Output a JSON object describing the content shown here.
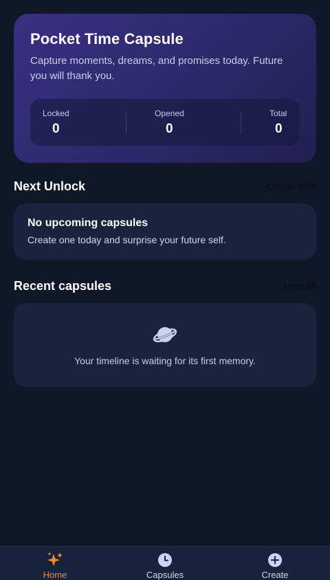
{
  "hero": {
    "title": "Pocket Time Capsule",
    "subtitle": "Capture moments, dreams, and promises today. Future you will thank you.",
    "stats": [
      {
        "label": "Locked",
        "value": "0"
      },
      {
        "label": "Opened",
        "value": "0"
      },
      {
        "label": "Total",
        "value": "0"
      }
    ]
  },
  "next_unlock": {
    "title": "Next Unlock",
    "action_label": "Create new",
    "card_title": "No upcoming capsules",
    "card_description": "Create one today and surprise your future self."
  },
  "recent": {
    "title": "Recent capsules",
    "action_label": "View all",
    "empty_icon": "planet-icon",
    "empty_text": "Your timeline is waiting for its first memory."
  },
  "bottom_nav": {
    "items": [
      {
        "label": "Home",
        "icon": "sparkles-icon",
        "active": true
      },
      {
        "label": "Capsules",
        "icon": "clock-icon",
        "active": false
      },
      {
        "label": "Create",
        "icon": "plus-circle-icon",
        "active": false
      }
    ]
  },
  "colors": {
    "background": "#101729",
    "card": "#18233d",
    "hero_gradient_start": "#3a2f82",
    "hero_gradient_end": "#231f52",
    "accent": "#f08a32",
    "nav_icon": "#c9d4f2"
  }
}
